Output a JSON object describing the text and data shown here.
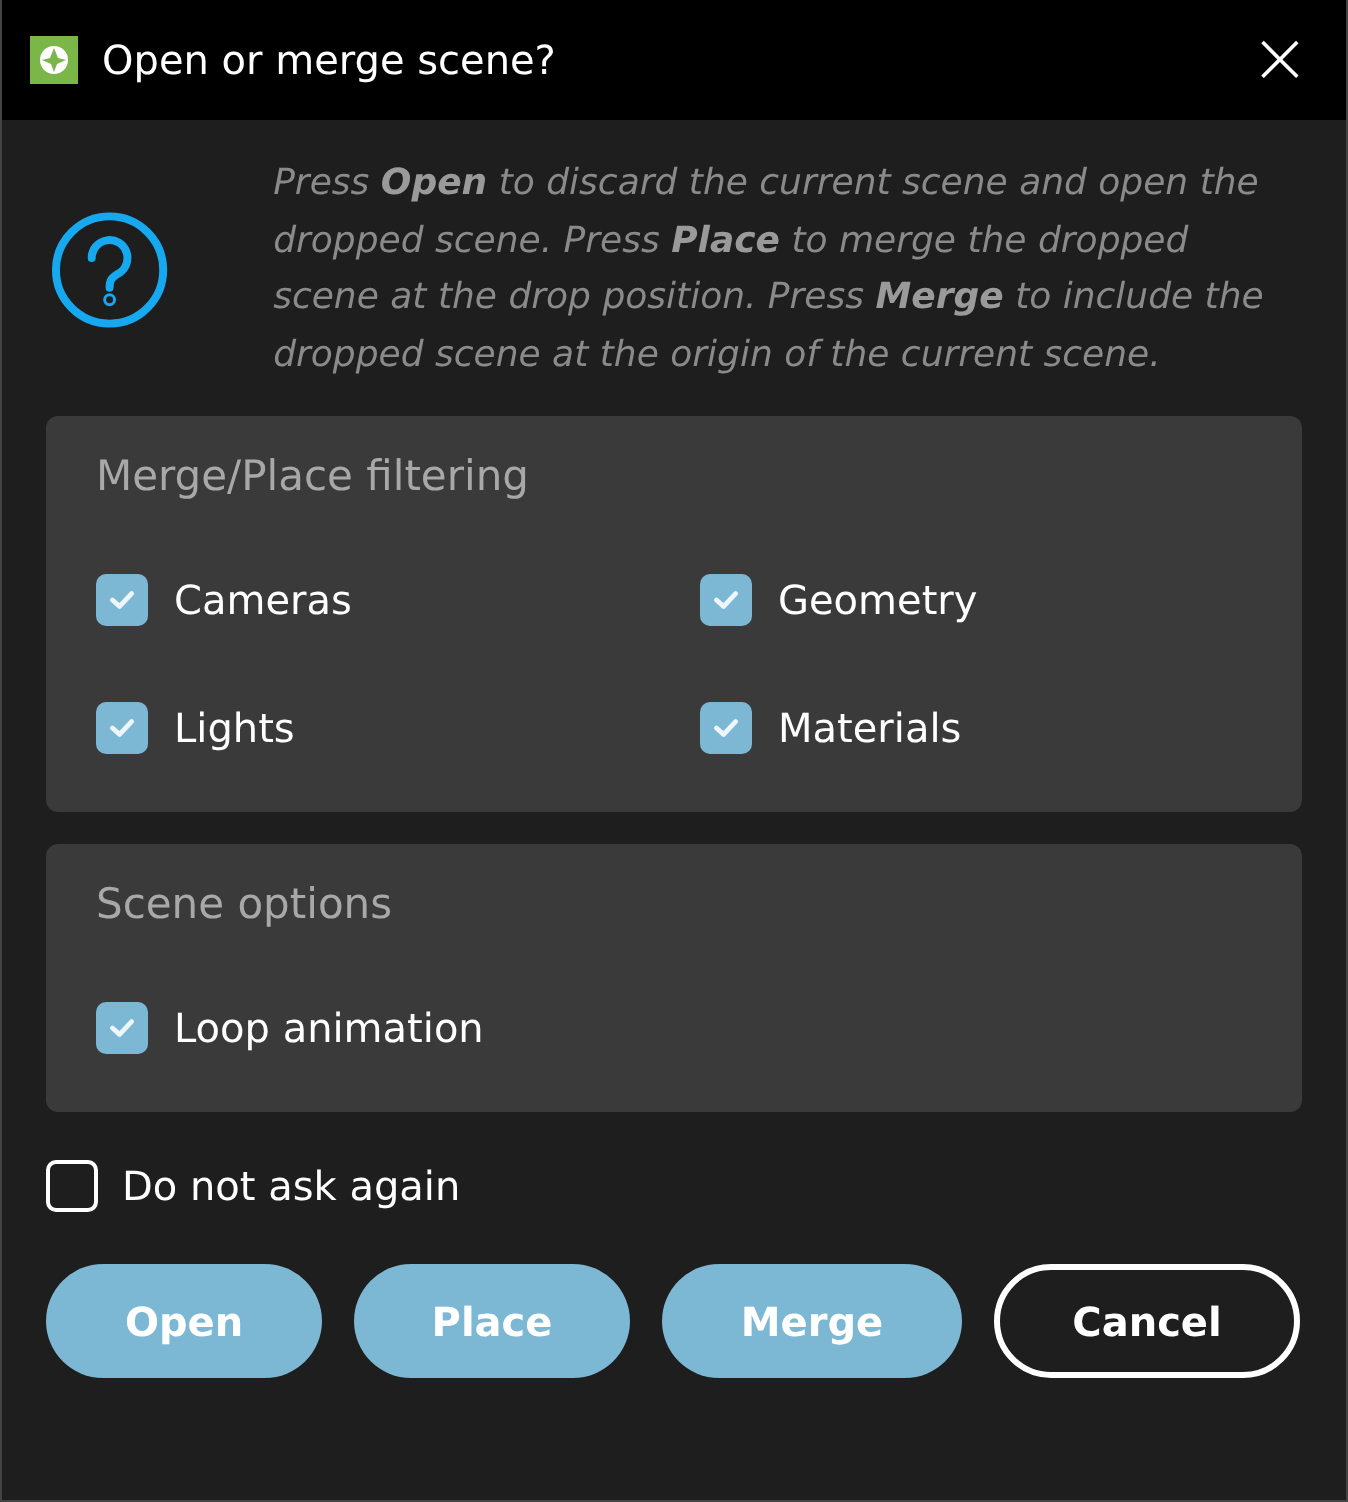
{
  "window": {
    "title": "Open or merge scene?",
    "close": "×"
  },
  "message": "Press **Open** to discard the current scene and open the dropped scene. Press **Place** to merge the dropped scene at the drop position. Press **Merge** to include the dropped scene at the origin of the current scene.",
  "sections": [
    {
      "title": "Merge/Place filtering",
      "options": [
        {
          "label": "Cameras",
          "checked": true
        },
        {
          "label": "Geometry",
          "checked": true
        },
        {
          "label": "Lights",
          "checked": true
        },
        {
          "label": "Materials",
          "checked": true
        }
      ]
    },
    {
      "title": "Scene options",
      "options": [
        {
          "label": "Loop animation",
          "checked": true
        }
      ]
    }
  ],
  "do_not_ask": {
    "label": "Do not ask again",
    "checked": false
  },
  "buttons": [
    {
      "label": "Open",
      "kind": "primary"
    },
    {
      "label": "Place",
      "kind": "primary"
    },
    {
      "label": "Merge",
      "kind": "primary"
    },
    {
      "label": "Cancel",
      "kind": "outline"
    }
  ]
}
